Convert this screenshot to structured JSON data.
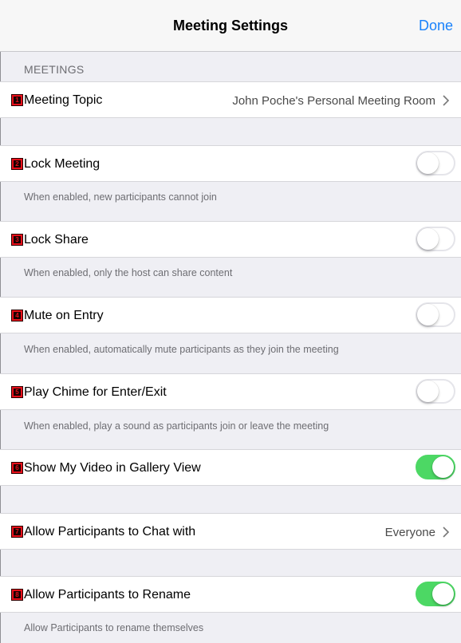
{
  "nav": {
    "title": "Meeting Settings",
    "done_label": "Done"
  },
  "section": {
    "header": "MEETINGS"
  },
  "rows": [
    {
      "badge": "1",
      "label": "Meeting Topic",
      "value": "John Poche's Personal Meeting Room"
    },
    {
      "badge": "2",
      "label": "Lock Meeting",
      "toggle": "off",
      "footnote": "When enabled, new participants cannot join"
    },
    {
      "badge": "3",
      "label": "Lock Share",
      "toggle": "off",
      "footnote": "When enabled, only the host can share content"
    },
    {
      "badge": "4",
      "label": "Mute on Entry",
      "toggle": "off",
      "footnote": "When enabled, automatically mute participants as they join the meeting"
    },
    {
      "badge": "5",
      "label": "Play Chime for Enter/Exit",
      "toggle": "off",
      "footnote": "When enabled, play a sound as participants join or leave the meeting"
    },
    {
      "badge": "6",
      "label": "Show My Video in Gallery View",
      "toggle": "on"
    },
    {
      "badge": "7",
      "label": "Allow Participants to Chat with",
      "value": "Everyone"
    },
    {
      "badge": "8",
      "label": "Allow Participants to Rename",
      "toggle": "on",
      "footnote": "Allow Participants to rename themselves"
    }
  ],
  "colors": {
    "accent": "#1a82fb",
    "toggle_on": "#4cd864",
    "badge": "#e8101b",
    "background": "#efeff4"
  },
  "icons": {
    "disclosure": "chevron-right-icon"
  }
}
